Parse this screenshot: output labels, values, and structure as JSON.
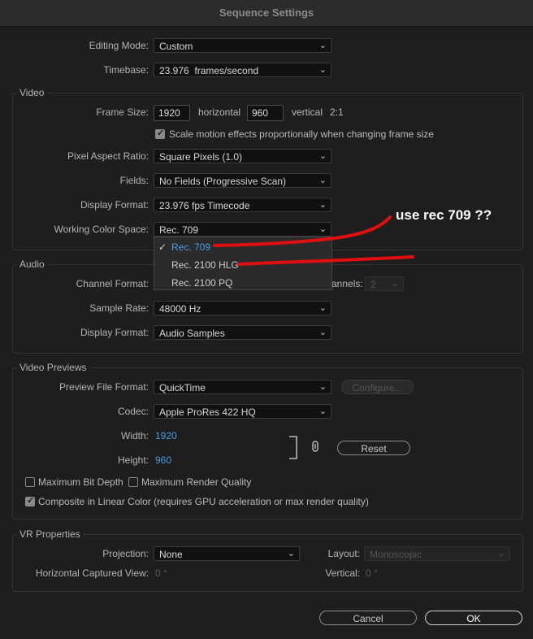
{
  "window": {
    "title": "Sequence Settings"
  },
  "general": {
    "editing_mode": {
      "label": "Editing Mode:",
      "value": "Custom"
    },
    "timebase": {
      "label": "Timebase:",
      "value": "23.976  frames/second"
    }
  },
  "video": {
    "title": "Video",
    "frame_size_label": "Frame Size:",
    "frame_width": "1920",
    "horizontal_label": "horizontal",
    "frame_height": "960",
    "vertical_label": "vertical",
    "ratio": "2:1",
    "scale_motion_label": "Scale motion effects proportionally when changing frame size",
    "scale_motion_checked": true,
    "pixel_aspect": {
      "label": "Pixel Aspect Ratio:",
      "value": "Square Pixels (1.0)"
    },
    "fields": {
      "label": "Fields:",
      "value": "No Fields (Progressive Scan)"
    },
    "display_format": {
      "label": "Display Format:",
      "value": "23.976 fps Timecode"
    },
    "working_color_space": {
      "label": "Working Color Space:",
      "value": "Rec. 709",
      "options": [
        "Rec. 709",
        "Rec. 2100 HLG",
        "Rec. 2100 PQ"
      ],
      "selected_index": 0
    }
  },
  "audio": {
    "title": "Audio",
    "channel_format_label": "Channel Format:",
    "channels_label": "annels:",
    "channels_value": "2",
    "sample_rate": {
      "label": "Sample Rate:",
      "value": "48000 Hz"
    },
    "display_format": {
      "label": "Display Format:",
      "value": "Audio Samples"
    }
  },
  "previews": {
    "title": "Video Previews",
    "preview_file_format": {
      "label": "Preview File Format:",
      "value": "QuickTime"
    },
    "configure_label": "Configure...",
    "codec": {
      "label": "Codec:",
      "value": "Apple ProRes 422 HQ"
    },
    "width_label": "Width:",
    "width_value": "1920",
    "height_label": "Height:",
    "height_value": "960",
    "reset_label": "Reset",
    "max_bit_depth_label": "Maximum Bit Depth",
    "max_bit_depth_checked": false,
    "max_render_quality_label": "Maximum Render Quality",
    "max_render_quality_checked": false,
    "composite_linear_label": "Composite in Linear Color (requires GPU acceleration or max render quality)",
    "composite_linear_checked": true
  },
  "vr": {
    "title": "VR Properties",
    "projection": {
      "label": "Projection:",
      "value": "None"
    },
    "layout": {
      "label": "Layout:",
      "value": "Monoscopic"
    },
    "horizontal_view_label": "Horizontal Captured View:",
    "horizontal_view_value": "0 °",
    "vertical_label": "Vertical:",
    "vertical_value": "0 °"
  },
  "buttons": {
    "cancel": "Cancel",
    "ok": "OK"
  },
  "annotation": {
    "text": "use rec 709 ??",
    "color": "#e01010"
  },
  "colors": {
    "background": "#1e1e1e",
    "accent_blue": "#4a9cdf",
    "annotation_red": "#e01010"
  }
}
